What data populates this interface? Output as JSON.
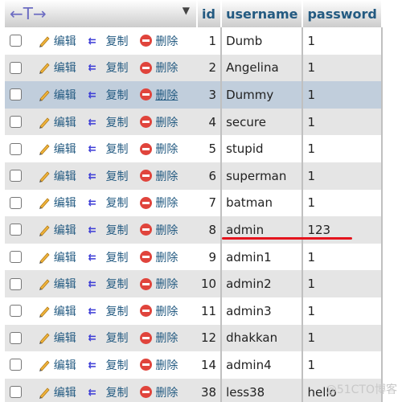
{
  "header": {
    "arrows": "←T→",
    "sort_icon": "▼",
    "columns": [
      "id",
      "username",
      "password"
    ]
  },
  "actions": {
    "edit": "编辑",
    "copy": "复制",
    "delete": "删除"
  },
  "rows": [
    {
      "id": "1",
      "username": "Dumb",
      "password": "1"
    },
    {
      "id": "2",
      "username": "Angelina",
      "password": "1"
    },
    {
      "id": "3",
      "username": "Dummy",
      "password": "1"
    },
    {
      "id": "4",
      "username": "secure",
      "password": "1"
    },
    {
      "id": "5",
      "username": "stupid",
      "password": "1"
    },
    {
      "id": "6",
      "username": "superman",
      "password": "1"
    },
    {
      "id": "7",
      "username": "batman",
      "password": "1"
    },
    {
      "id": "8",
      "username": "admin",
      "password": "123"
    },
    {
      "id": "9",
      "username": "admin1",
      "password": "1"
    },
    {
      "id": "10",
      "username": "admin2",
      "password": "1"
    },
    {
      "id": "11",
      "username": "admin3",
      "password": "1"
    },
    {
      "id": "12",
      "username": "dhakkan",
      "password": "1"
    },
    {
      "id": "14",
      "username": "admin4",
      "password": "1"
    },
    {
      "id": "38",
      "username": "less38",
      "password": "hello"
    }
  ],
  "hover_row_index": 2,
  "watermark": "@51CTO博客"
}
